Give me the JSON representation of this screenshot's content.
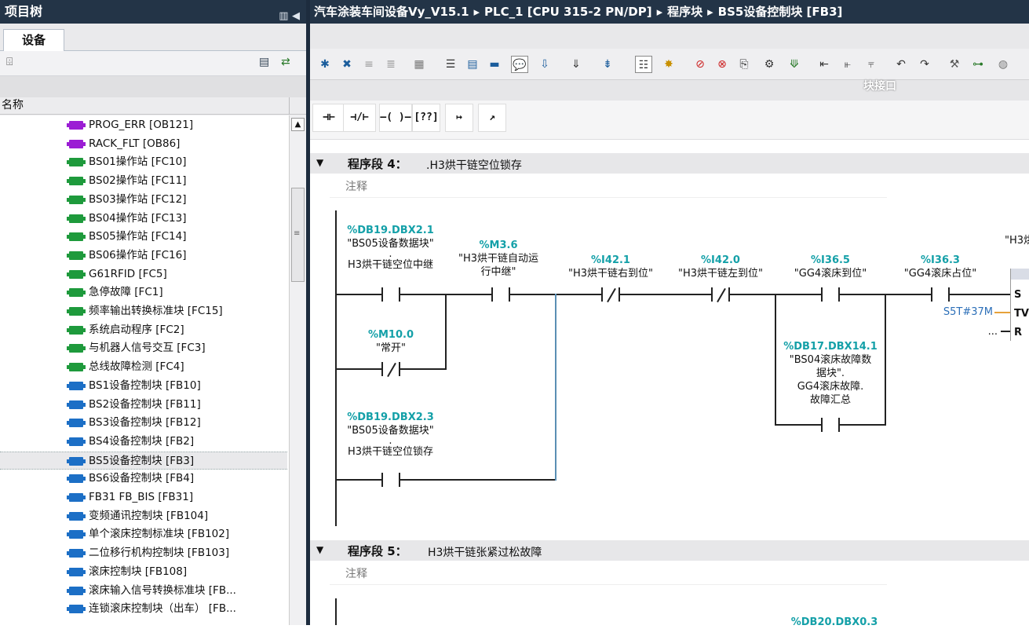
{
  "left_panel": {
    "title": "项目树",
    "device_tab": "设备",
    "column_header": "名称",
    "items": [
      {
        "label": "PROG_ERR [OB121]",
        "color": "#9b1dd4"
      },
      {
        "label": "RACK_FLT [OB86]",
        "color": "#9b1dd4"
      },
      {
        "label": "BS01操作站 [FC10]",
        "color": "#1e9a3c"
      },
      {
        "label": "BS02操作站 [FC11]",
        "color": "#1e9a3c"
      },
      {
        "label": "BS03操作站 [FC12]",
        "color": "#1e9a3c"
      },
      {
        "label": "BS04操作站 [FC13]",
        "color": "#1e9a3c"
      },
      {
        "label": "BS05操作站 [FC14]",
        "color": "#1e9a3c"
      },
      {
        "label": "BS06操作站 [FC16]",
        "color": "#1e9a3c"
      },
      {
        "label": "G61RFID [FC5]",
        "color": "#1e9a3c"
      },
      {
        "label": "急停故障 [FC1]",
        "color": "#1e9a3c"
      },
      {
        "label": "频率输出转换标准块 [FC15]",
        "color": "#1e9a3c"
      },
      {
        "label": "系统启动程序 [FC2]",
        "color": "#1e9a3c"
      },
      {
        "label": "与机器人信号交互 [FC3]",
        "color": "#1e9a3c"
      },
      {
        "label": "总线故障检测 [FC4]",
        "color": "#1e9a3c"
      },
      {
        "label": "BS1设备控制块 [FB10]",
        "color": "#1c6fc6"
      },
      {
        "label": "BS2设备控制块 [FB11]",
        "color": "#1c6fc6"
      },
      {
        "label": "BS3设备控制块 [FB12]",
        "color": "#1c6fc6"
      },
      {
        "label": "BS4设备控制块 [FB2]",
        "color": "#1c6fc6"
      },
      {
        "label": "BS5设备控制块 [FB3]",
        "color": "#1c6fc6",
        "selected": true
      },
      {
        "label": "BS6设备控制块 [FB4]",
        "color": "#1c6fc6"
      },
      {
        "label": "FB31 FB_BIS [FB31]",
        "color": "#1c6fc6"
      },
      {
        "label": "变频通讯控制块 [FB104]",
        "color": "#1c6fc6"
      },
      {
        "label": "单个滚床控制标准块 [FB102]",
        "color": "#1c6fc6"
      },
      {
        "label": "二位移行机构控制块 [FB103]",
        "color": "#1c6fc6"
      },
      {
        "label": "滚床控制块 [FB108]",
        "color": "#1c6fc6"
      },
      {
        "label": "滚床输入信号转换标准块 [FB...",
        "color": "#1c6fc6"
      },
      {
        "label": "连锁滚床控制块（出车） [FB...",
        "color": "#1c6fc6"
      }
    ]
  },
  "breadcrumb": [
    "汽车涂装车间设备Vy_V15.1",
    "PLC_1 [CPU 315-2 PN/DP]",
    "程序块",
    "BS5设备控制块 [FB3]"
  ],
  "breadcrumb_sep": "▸",
  "interface_label": "块接口",
  "ladder_toolbar": [
    "⊣⊢",
    "⊣/⊢",
    "–( )–",
    "[??]",
    "↦",
    "↗"
  ],
  "network4": {
    "label": "程序段 4：",
    "title": ".H3烘干链空位锁存",
    "comment": "注释",
    "ops": {
      "c1": {
        "addr": "%DB19.DBX2.1",
        "name": "\"BS05设备数据块\"",
        "dot": ".",
        "sub": "H3烘干链空位中继"
      },
      "c2": {
        "addr": "%M3.6",
        "name": "\"H3烘干链自动运",
        "name2": "行中继\""
      },
      "c3": {
        "addr": "%I42.1",
        "name": "\"H3烘干链右到位\""
      },
      "c4": {
        "addr": "%I42.0",
        "name": "\"H3烘干链左到位\""
      },
      "c5": {
        "addr": "%I36.5",
        "name": "\"GG4滚床到位\""
      },
      "c6": {
        "addr": "%I36.3",
        "name": "\"GG4滚床占位\""
      },
      "b1": {
        "addr": "%M10.0",
        "name": "\"常开\""
      },
      "b2": {
        "addr": "%DB19.DBX2.3",
        "name": "\"BS05设备数据块\"",
        "dot": ".",
        "sub": "H3烘干链空位锁存"
      },
      "b3": {
        "addr": "%DB17.DBX14.1",
        "name": "\"BS04滚床故障数",
        "name2": "据块\".",
        "sub": "GG4滚床故障.",
        "sub2": "故障汇总"
      },
      "timer_partial": "\"H3烘",
      "timer_pins": [
        "S",
        "TV",
        "R"
      ],
      "timer_tv": "S5T#37M",
      "timer_r": "..."
    }
  },
  "network5": {
    "label": "程序段 5：",
    "title": "H3烘干链张紧过松故障",
    "comment": "注释",
    "partial_addr": "%DB20.DBX0.3"
  }
}
